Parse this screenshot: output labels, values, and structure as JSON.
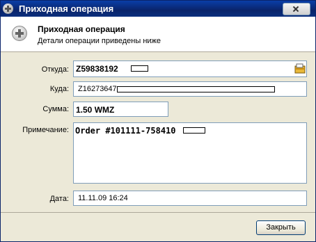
{
  "window": {
    "title": "Приходная операция"
  },
  "header": {
    "title": "Приходная операция",
    "subtitle": "Детали операции приведены ниже"
  },
  "form": {
    "from_label": "Откуда:",
    "from_value": "Z59838192",
    "to_label": "Куда:",
    "to_value": "Z16273647",
    "amount_label": "Сумма:",
    "amount_value": "1.50 WMZ",
    "note_label": "Примечание:",
    "note_value": "Order #101111-758410",
    "date_label": "Дата:",
    "date_value": "11.11.09 16:24"
  },
  "buttons": {
    "close_label": "Закрыть"
  },
  "icons": {
    "title_icon": "plus-circle-icon",
    "header_icon": "plus-circle-icon",
    "wallet_icon": "wallet-icon",
    "close_icon": "close-icon"
  }
}
